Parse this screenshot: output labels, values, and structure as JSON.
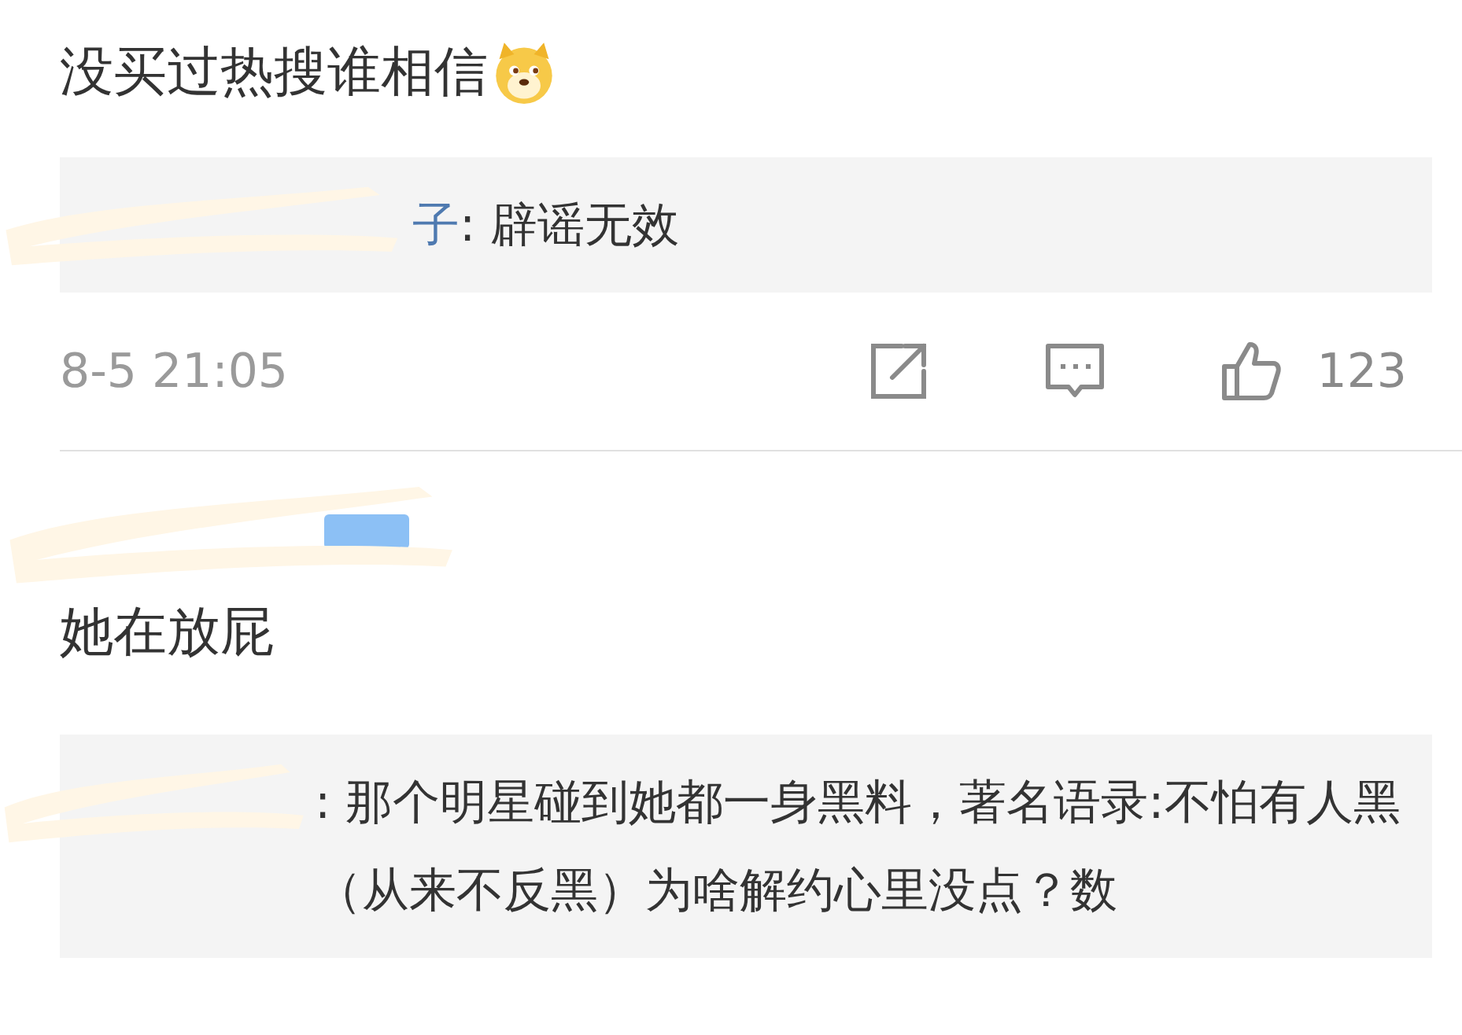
{
  "comments": [
    {
      "text": "没买过热搜谁相信",
      "reply": {
        "redacted": true,
        "author": "子",
        "text": ": 辟谣无效"
      },
      "meta": {
        "time": "8-5 21:05",
        "likes": "123"
      }
    },
    {
      "redacted_header": true,
      "text": "她在放屁",
      "reply": {
        "redacted": true,
        "text": ": 那个明星碰到她都一身黑料，著名语录:不怕有人黑（从来不反黑）为啥解约心里没点？数"
      }
    }
  ]
}
